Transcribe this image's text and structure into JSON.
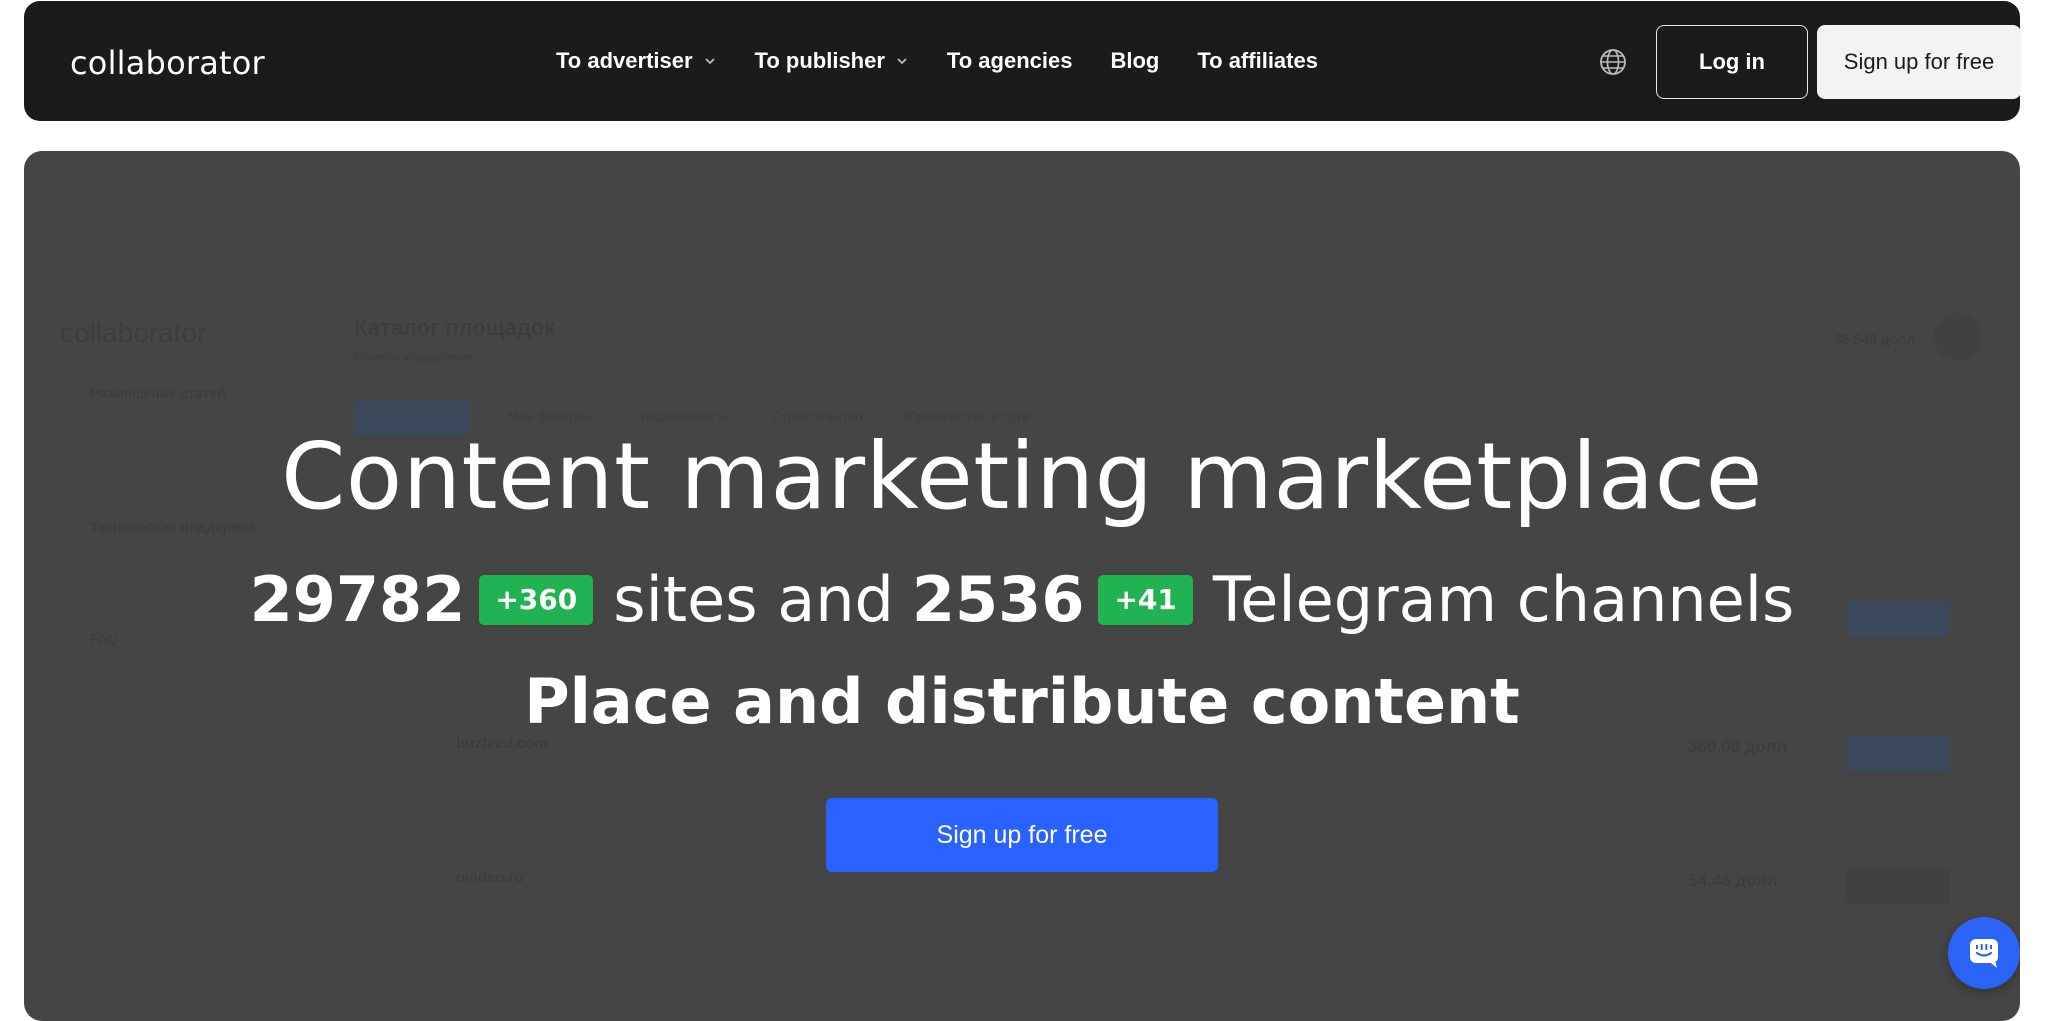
{
  "header": {
    "logo_text": "collaborator",
    "nav": [
      {
        "label": "To advertiser",
        "has_dropdown": true
      },
      {
        "label": "To publisher",
        "has_dropdown": true
      },
      {
        "label": "To agencies",
        "has_dropdown": false
      },
      {
        "label": "Blog",
        "has_dropdown": false
      },
      {
        "label": "To affiliates",
        "has_dropdown": false
      }
    ],
    "language_icon": "globe-icon",
    "login_label": "Log in",
    "signup_label": "Sign up for free"
  },
  "hero": {
    "title": "Content marketing marketplace",
    "sites_count": "29782",
    "sites_delta": "+360",
    "sites_text": "sites and",
    "channels_count": "2536",
    "channels_delta": "+41",
    "channels_text": "Telegram channels",
    "subtitle": "Place and distribute content",
    "cta_label": "Sign up for free"
  },
  "background_mock": {
    "logo": "collaborator",
    "page_title": "Каталог площадок",
    "breadcrumb": "Панель управления",
    "balance": "35 546 долл",
    "sidebar": [
      "Размещение статей",
      "Техническая поддержка",
      "FAQ"
    ],
    "filters": [
      "Мои фильтры",
      "Недвижимость",
      "Строительство",
      "Юридические услуги"
    ],
    "sites": [
      "buzfeed.com",
      "ovideo.ru"
    ],
    "prices": [
      "360.00 долл",
      "54.46 долл"
    ]
  },
  "colors": {
    "nav_bg": "#1b1b1b",
    "hero_bg": "#454545",
    "badge_green": "#21b352",
    "cta_blue": "#2962ff",
    "chat_blue": "#2b63f5"
  },
  "chat_icon": "chat-icon"
}
